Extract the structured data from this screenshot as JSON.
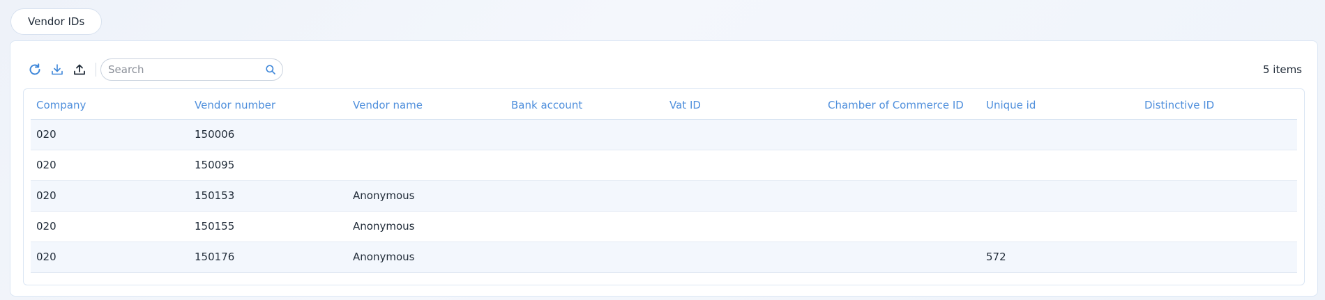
{
  "tabs": [
    {
      "label": "Vendor IDs"
    }
  ],
  "toolbar": {
    "refresh_icon": "refresh-icon",
    "download_icon": "download-icon",
    "upload_icon": "upload-icon",
    "search_placeholder": "Search",
    "search_value": "",
    "item_count": "5 items"
  },
  "colors": {
    "accent": "#4f8fdc",
    "row_alt": "#f3f7fd",
    "text": "#1f2a37"
  },
  "table": {
    "columns": [
      "Company",
      "Vendor number",
      "Vendor name",
      "Bank account",
      "Vat ID",
      "Chamber of Commerce ID",
      "Unique id",
      "Distinctive ID"
    ],
    "rows": [
      [
        "020",
        "150006",
        "",
        "",
        "",
        "",
        "",
        ""
      ],
      [
        "020",
        "150095",
        "",
        "",
        "",
        "",
        "",
        ""
      ],
      [
        "020",
        "150153",
        "Anonymous",
        "",
        "",
        "",
        "",
        ""
      ],
      [
        "020",
        "150155",
        "Anonymous",
        "",
        "",
        "",
        "",
        ""
      ],
      [
        "020",
        "150176",
        "Anonymous",
        "",
        "",
        "",
        "572",
        ""
      ]
    ]
  }
}
